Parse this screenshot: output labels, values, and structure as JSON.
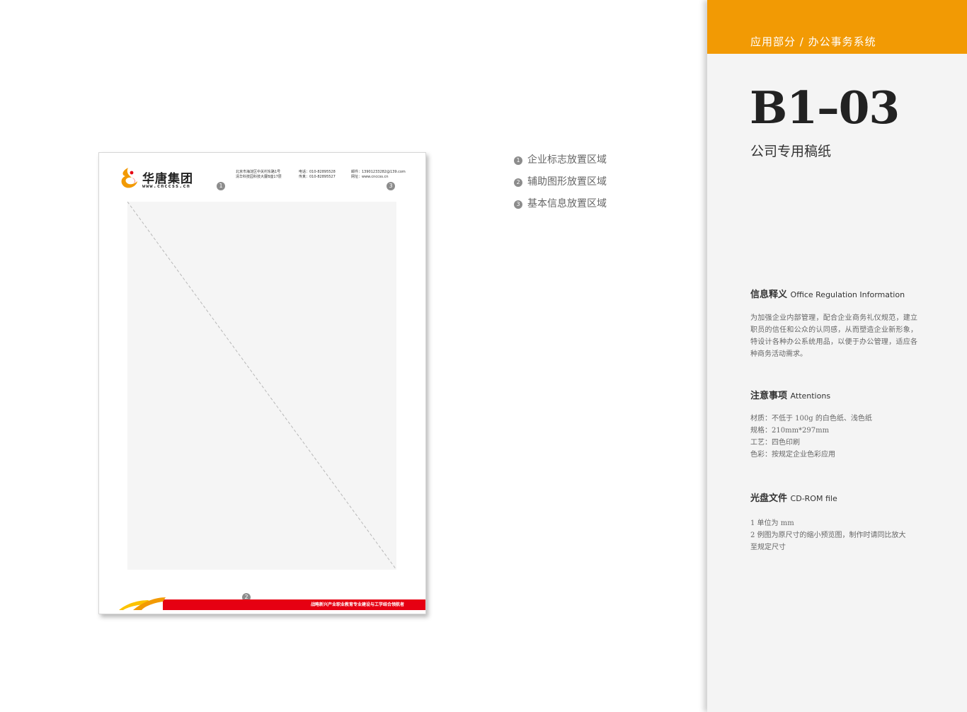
{
  "sheet": {
    "logo_text": "华唐集团",
    "logo_url": "www.cnccss.cn",
    "address": [
      "北京市海淀区中关村东路1号",
      "清华科技园科技大厦B座17层"
    ],
    "phone": [
      "电话：010-82895528",
      "传真：010-82895527"
    ],
    "email": [
      "邮件：13901233282@139.com",
      "网址：www.cnccss.cn"
    ],
    "badges": [
      "1",
      "3",
      "2"
    ],
    "slogan": "战略新兴产业职业教育专业建设与工学结合领航者",
    "colors": {
      "red": "#e60012",
      "orange": "#f29a04",
      "yellow": "#fcc300"
    }
  },
  "legend": [
    {
      "num": "1",
      "text": "企业标志放置区域"
    },
    {
      "num": "2",
      "text": "辅助图形放置区域"
    },
    {
      "num": "3",
      "text": "基本信息放置区域"
    }
  ],
  "panel": {
    "header": "应用部分 / 办公事务系统",
    "code": "B1–03",
    "subtitle": "公司专用稿纸",
    "accent": "#f29a04",
    "sections": [
      {
        "title": "信息释义",
        "title_en": "Office Regulation Information",
        "paragraph": "为加强企业内部管理，配合企业商务礼仪规范，建立职员的信任和公众的认同感，从而塑造企业新形象，特设计各种办公系统用品，以便于办公管理，适应各种商务活动需求。"
      },
      {
        "title": "注意事项",
        "title_en": "Attentions",
        "lines": [
          "材质：不低于 100g 的白色纸、浅色纸",
          "规格：210mm*297mm",
          "工艺：四色印刷",
          "色彩：按规定企业色彩应用"
        ]
      },
      {
        "title": "光盘文件",
        "title_en": "CD-ROM file",
        "lines": [
          "1 单位为 mm",
          "2  例图为原尺寸的缩小预览图，制作时请同比放大",
          "至规定尺寸"
        ]
      }
    ]
  }
}
